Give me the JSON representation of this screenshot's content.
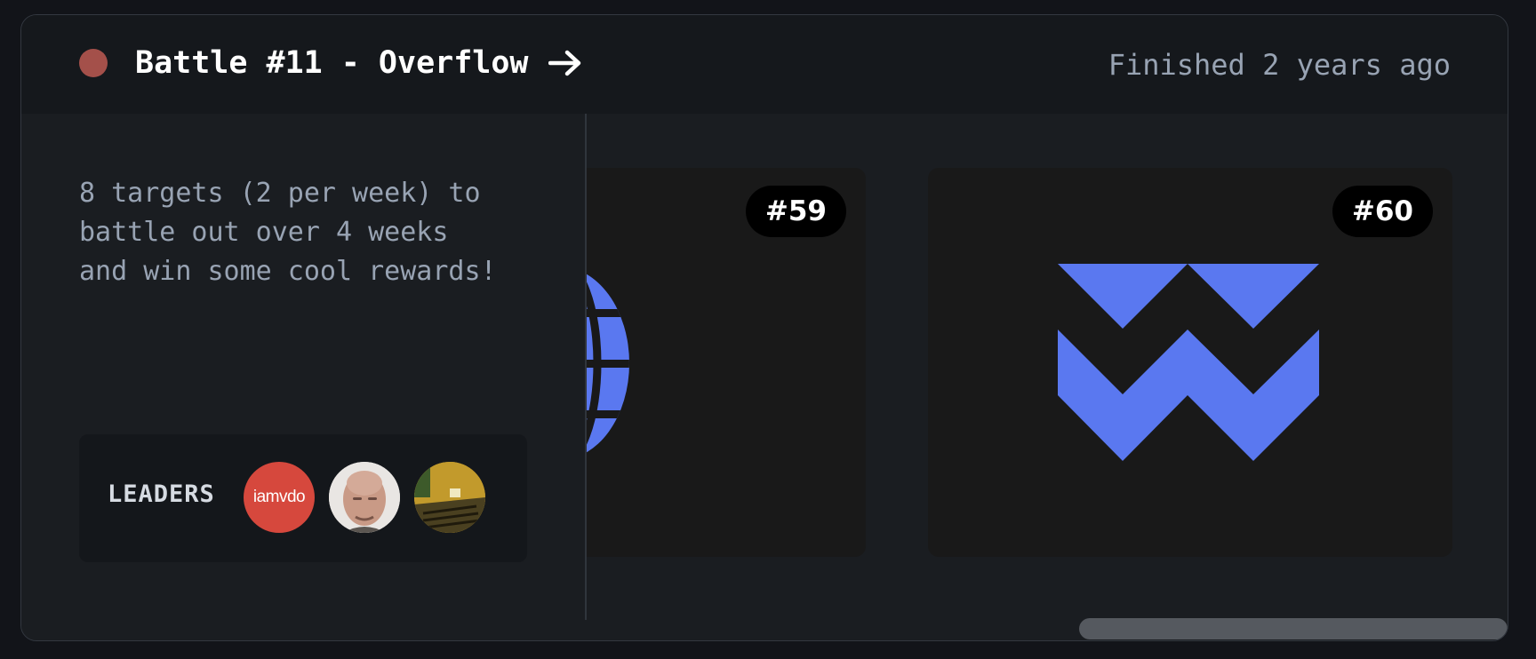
{
  "battle": {
    "title": "Battle #11 - Overflow",
    "status": "Finished 2 years ago",
    "description": "8 targets (2 per week) to\nbattle out over 4 weeks\nand win some cool rewards!",
    "status_color": "#a4504a"
  },
  "leaders": {
    "label": "LEADERS",
    "avatars": [
      {
        "text": "iamvdo",
        "color": "#d6483d"
      },
      {
        "text": "",
        "color": "#e7e4e2"
      },
      {
        "text": "",
        "color": "#b8902c"
      }
    ]
  },
  "targets": [
    {
      "number": "#59",
      "icon": "globe-icon",
      "color": "#5a78f0"
    },
    {
      "number": "#60",
      "icon": "zigzag-logo-icon",
      "color": "#5a78f0"
    }
  ],
  "colors": {
    "accent": "#5a78f0",
    "card_bg": "#191919",
    "text_muted": "#98a3b3"
  }
}
